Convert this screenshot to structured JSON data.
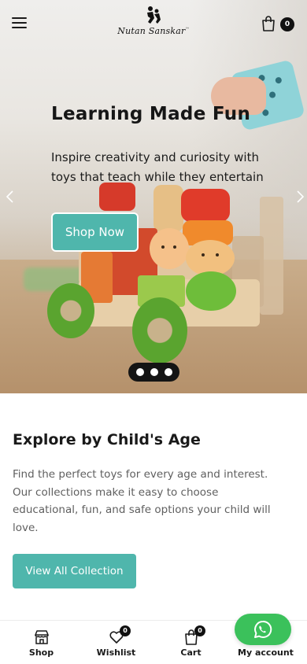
{
  "header": {
    "brand": "Nutan Sanskar",
    "brand_mark": "™",
    "cart_count": "0"
  },
  "hero": {
    "title": "Learning Made Fun",
    "subtitle": "Inspire creativity and curiosity with toys that teach while they entertain",
    "cta_label": "Shop Now",
    "slides_total": 3,
    "active_slide": 1
  },
  "age_section": {
    "title": "Explore by Child's Age",
    "description": "Find the perfect toys for every age and interest. Our collections make it easy to choose educational, fun, and safe options your child will love.",
    "cta_label": "View All Collection"
  },
  "bottom_nav": {
    "items": [
      {
        "label": "Shop",
        "icon": "store-icon"
      },
      {
        "label": "Wishlist",
        "icon": "heart-icon",
        "badge": "0"
      },
      {
        "label": "Cart",
        "icon": "shopping-bag-icon",
        "badge": "0"
      },
      {
        "label": "My account",
        "icon": "user-icon"
      }
    ]
  },
  "colors": {
    "accent": "#4fb6ac",
    "whatsapp": "#3bc15b",
    "badge": "#111111"
  }
}
